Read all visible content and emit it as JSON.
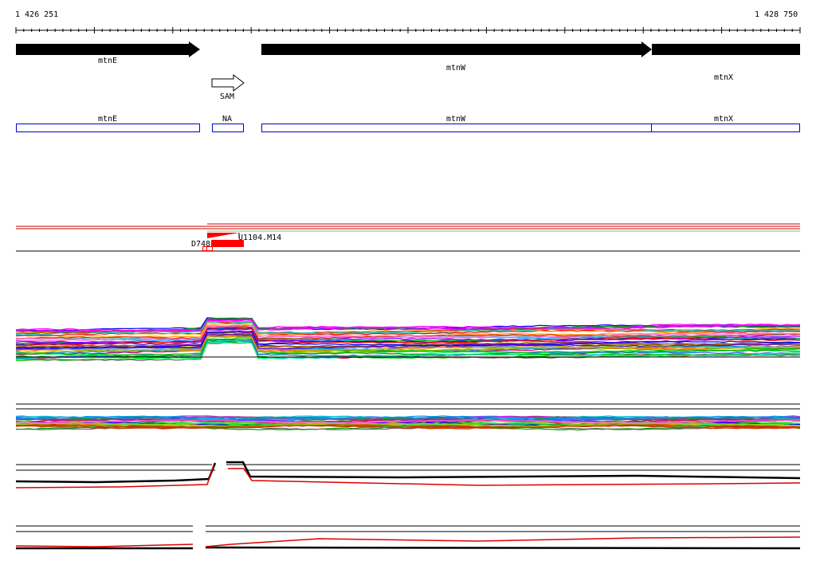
{
  "coordinates": {
    "start": "1 426 251",
    "end": "1 428 750"
  },
  "genes": [
    {
      "id": "mtnE",
      "label": "mtnE",
      "strand": "+",
      "filled": true
    },
    {
      "id": "mtnW",
      "label": "mtnW",
      "strand": "+",
      "filled": true
    },
    {
      "id": "mtnX",
      "label": "mtnX",
      "strand": "+",
      "filled": true
    },
    {
      "id": "SAM",
      "label": "SAM",
      "strand": "+",
      "filled": false
    }
  ],
  "annotation_track": [
    {
      "id": "mtnE",
      "label": "mtnE"
    },
    {
      "id": "NA",
      "label": "NA"
    },
    {
      "id": "mtnW",
      "label": "mtnW"
    },
    {
      "id": "mtnX",
      "label": "mtnX"
    }
  ],
  "features": {
    "primary": "U1104.M14",
    "secondary": "D748"
  },
  "colors": {
    "gene_fill": "#000000",
    "annotation_box": "#0000cc",
    "feature": "#ff0000",
    "outline": "#000000"
  }
}
